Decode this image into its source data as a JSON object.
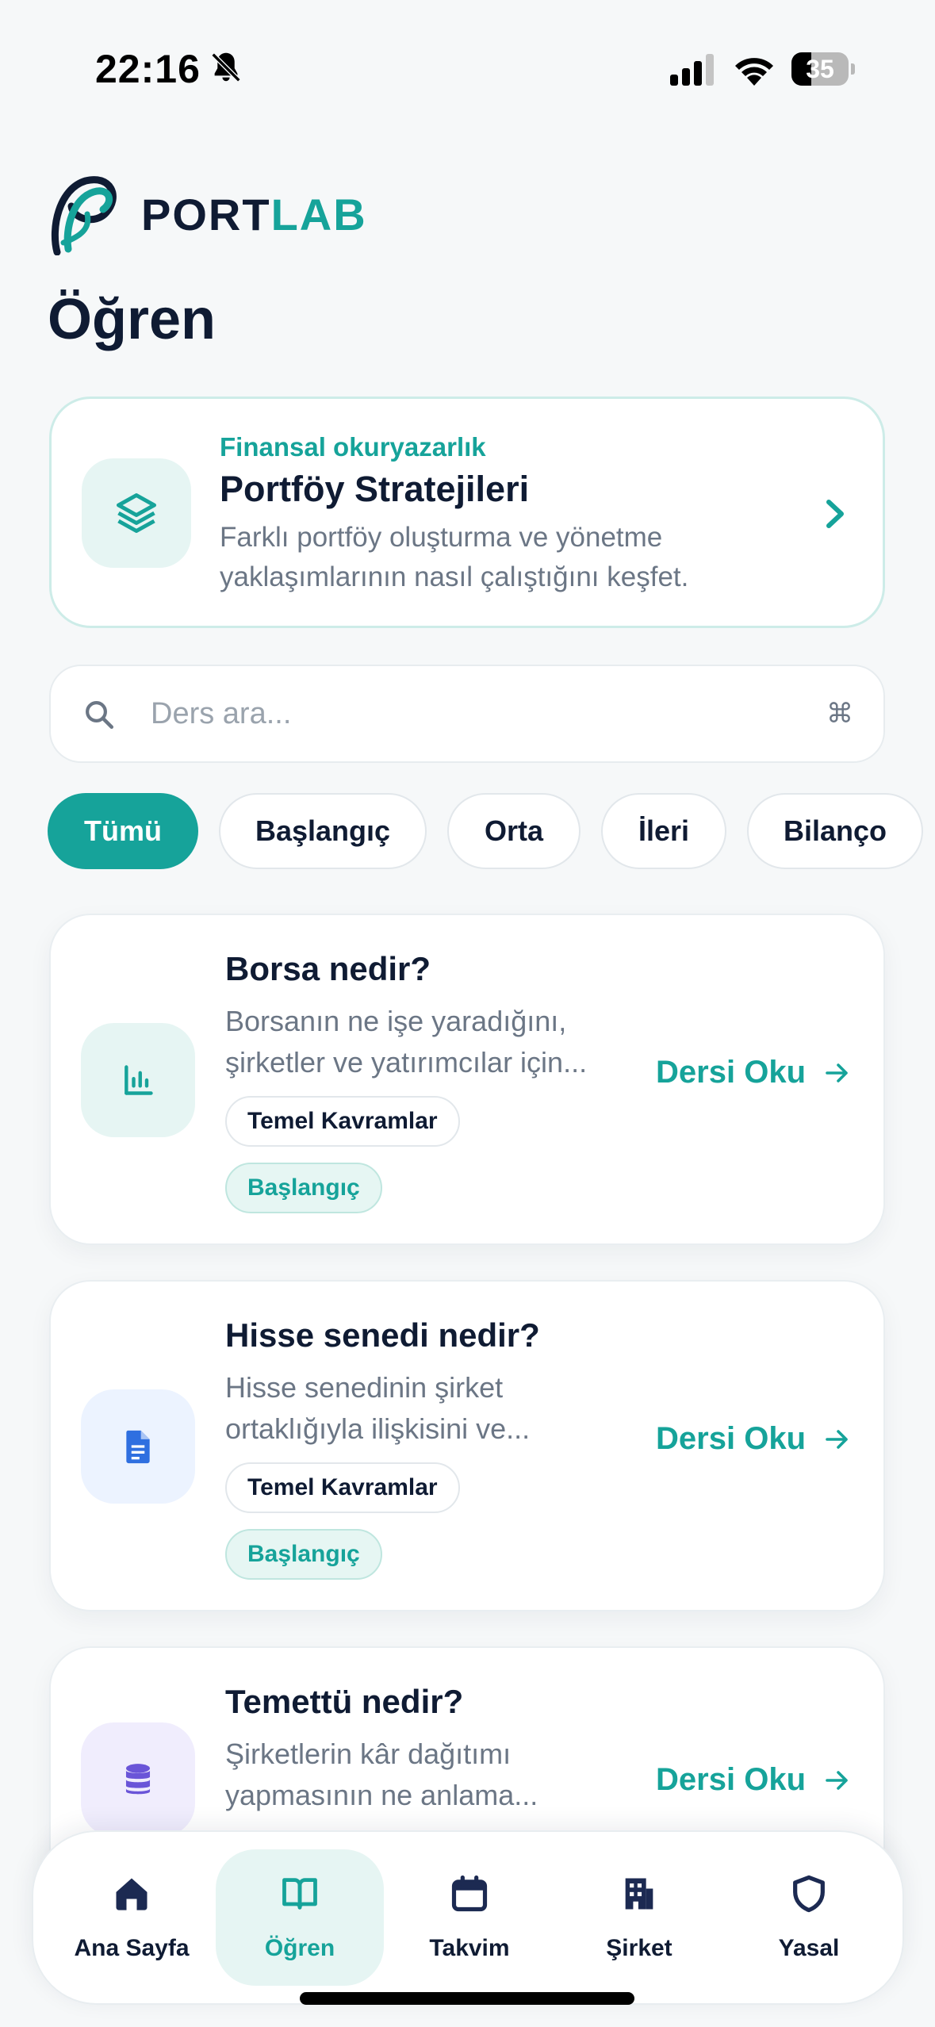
{
  "status_bar": {
    "time": "22:16",
    "battery_level": "35",
    "battery_fraction": 0.35
  },
  "brand": {
    "name_primary": "PORT",
    "name_accent": "LAB",
    "colors": {
      "teal": "#16a39a",
      "navy": "#0f1b33"
    }
  },
  "page": {
    "title": "Öğren"
  },
  "featured": {
    "eyebrow": "Finansal okuryazarlık",
    "title": "Portföy Stratejileri",
    "description": "Farklı portföy oluşturma ve yönetme yaklaşımlarının nasıl çalıştığını keşfet.",
    "icon": "layers-icon"
  },
  "search": {
    "placeholder": "Ders ara...",
    "value": "",
    "shortcut": "⌘"
  },
  "filters": [
    {
      "label": "Tümü",
      "active": true
    },
    {
      "label": "Başlangıç",
      "active": false
    },
    {
      "label": "Orta",
      "active": false
    },
    {
      "label": "İleri",
      "active": false
    },
    {
      "label": "Bilanço",
      "active": false
    }
  ],
  "lessons": [
    {
      "title": "Borsa nedir?",
      "description_lines": [
        "Borsanın ne işe yaradığını,",
        "şirketler ve yatırımcılar için..."
      ],
      "topic_tag": "Temel Kavramlar",
      "level_tag": "Başlangıç",
      "action": "Dersi Oku",
      "icon": "bar-chart-icon",
      "icon_color": "#16a39a",
      "icon_bg": "#e6f5f3"
    },
    {
      "title": "Hisse senedi nedir?",
      "description_lines": [
        "Hisse senedinin şirket",
        "ortaklığıyla ilişkisini ve..."
      ],
      "topic_tag": "Temel Kavramlar",
      "level_tag": "Başlangıç",
      "action": "Dersi Oku",
      "icon": "document-icon",
      "icon_color": "#2f6fe0",
      "icon_bg": "#ecf3ff"
    },
    {
      "title": "Temettü nedir?",
      "description_lines": [
        "Şirketlerin kâr dağıtımı",
        "yapmasının ne anlama..."
      ],
      "action": "Dersi Oku",
      "icon": "database-icon",
      "icon_color": "#6a55d8",
      "icon_bg": "#f0edfd"
    }
  ],
  "nav": [
    {
      "label": "Ana Sayfa",
      "icon": "home-icon",
      "active": false
    },
    {
      "label": "Öğren",
      "icon": "book-icon",
      "active": true
    },
    {
      "label": "Takvim",
      "icon": "calendar-icon",
      "active": false
    },
    {
      "label": "Şirket",
      "icon": "building-icon",
      "active": false
    },
    {
      "label": "Yasal",
      "icon": "shield-icon",
      "active": false
    }
  ]
}
